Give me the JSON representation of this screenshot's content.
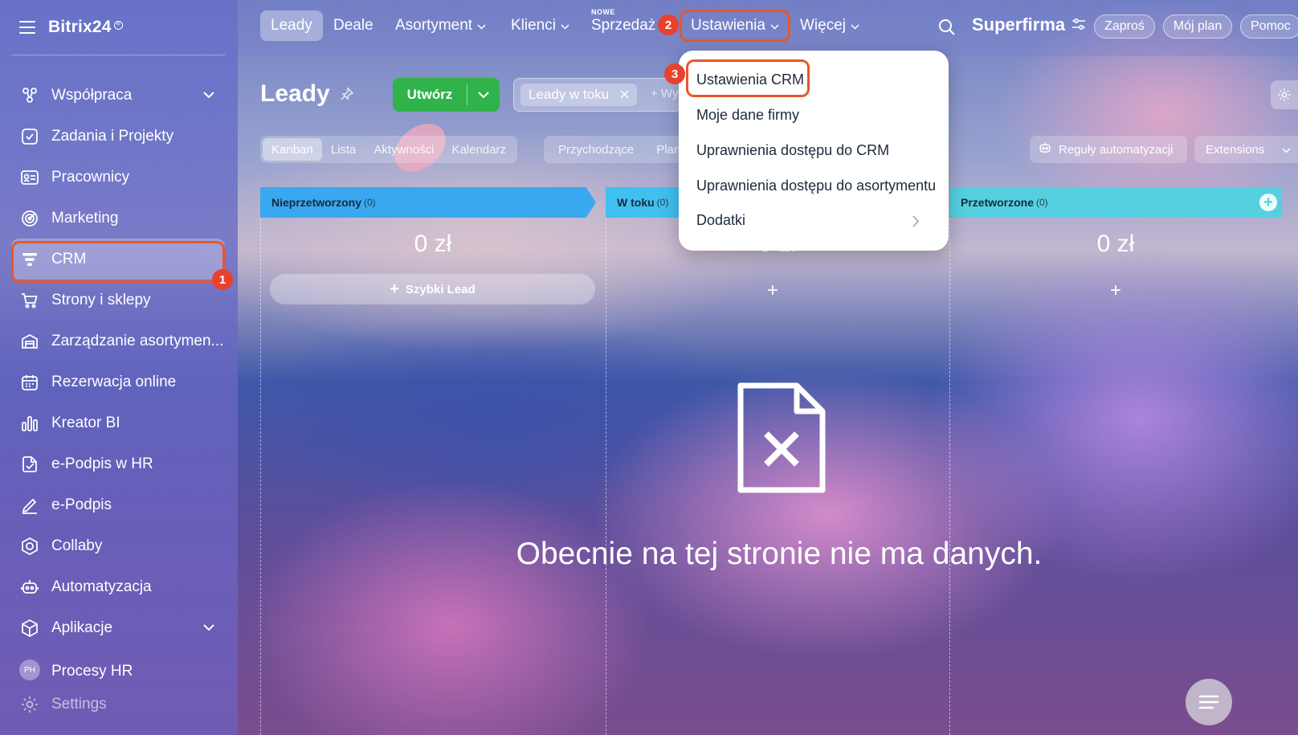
{
  "sidebar": {
    "logo": "Bitrix24",
    "items": [
      {
        "label": "Współpraca",
        "icon": "collab-icon",
        "chevron": true
      },
      {
        "label": "Zadania i Projekty",
        "icon": "tasks-icon"
      },
      {
        "label": "Pracownicy",
        "icon": "employees-icon"
      },
      {
        "label": "Marketing",
        "icon": "marketing-icon"
      },
      {
        "label": "CRM",
        "icon": "crm-funnel-icon",
        "active": true
      },
      {
        "label": "Strony i sklepy",
        "icon": "cart-icon"
      },
      {
        "label": "Zarządzanie asortymen...",
        "icon": "warehouse-icon"
      },
      {
        "label": "Rezerwacja online",
        "icon": "calendar-icon"
      },
      {
        "label": "Kreator BI",
        "icon": "bars-icon"
      },
      {
        "label": "e-Podpis w HR",
        "icon": "doc-sign-icon"
      },
      {
        "label": "e-Podpis",
        "icon": "pen-icon"
      },
      {
        "label": "Collaby",
        "icon": "hexagon-icon"
      },
      {
        "label": "Automatyzacja",
        "icon": "robot-icon"
      },
      {
        "label": "Aplikacje",
        "icon": "cube-icon",
        "chevron": true
      },
      {
        "label": "Procesy HR",
        "avatar": "PH"
      },
      {
        "label": "Settings",
        "icon": "gear-icon"
      }
    ]
  },
  "topbar": {
    "tabs": [
      {
        "label": "Leady",
        "active": true
      },
      {
        "label": "Deale"
      },
      {
        "label": "Asortyment",
        "chevron": true
      },
      {
        "label": "Klienci",
        "chevron": true
      },
      {
        "label": "Sprzedaż",
        "new_badge": "NOWE"
      },
      {
        "label": "Ustawienia",
        "chevron": true
      },
      {
        "label": "Więcej",
        "chevron": true
      }
    ],
    "company": "Superfirma",
    "buttons": {
      "invite": "Zaproś",
      "plan": "Mój plan",
      "help": "Pomoc"
    }
  },
  "toolbar": {
    "title": "Leady",
    "create_label": "Utwórz",
    "filter_chip": "Leady w toku",
    "filter_more": "+ Wyszukaj",
    "views": [
      "Kanban",
      "Lista",
      "Aktywności",
      "Kalendarz"
    ],
    "counters": [
      "Przychodzące",
      "Planowane"
    ],
    "automation_label": "Reguły automatyzacji",
    "extensions_label": "Extensions"
  },
  "kanban": {
    "columns": [
      {
        "name": "Nieprzetworzony",
        "count": "(0)",
        "sum": "0 zł",
        "color": "#39a8ef"
      },
      {
        "name": "W toku",
        "count": "(0)",
        "sum": "0 zł",
        "color": "#3fc0f0"
      },
      {
        "name": "Przetworzone",
        "count": "(0)",
        "sum": "0 zł",
        "color": "#55d0e0"
      }
    ],
    "quick_lead": "Szybki Lead",
    "empty_message": "Obecnie na tej stronie nie ma danych."
  },
  "menu": {
    "items": [
      "Ustawienia CRM",
      "Moje dane firmy",
      "Uprawnienia dostępu do CRM",
      "Uprawnienia dostępu do asortymentu",
      "Dodatki"
    ]
  },
  "annotations": {
    "step1": "1",
    "step2": "2",
    "step3": "3",
    "highlight_color": "#e8572a"
  }
}
